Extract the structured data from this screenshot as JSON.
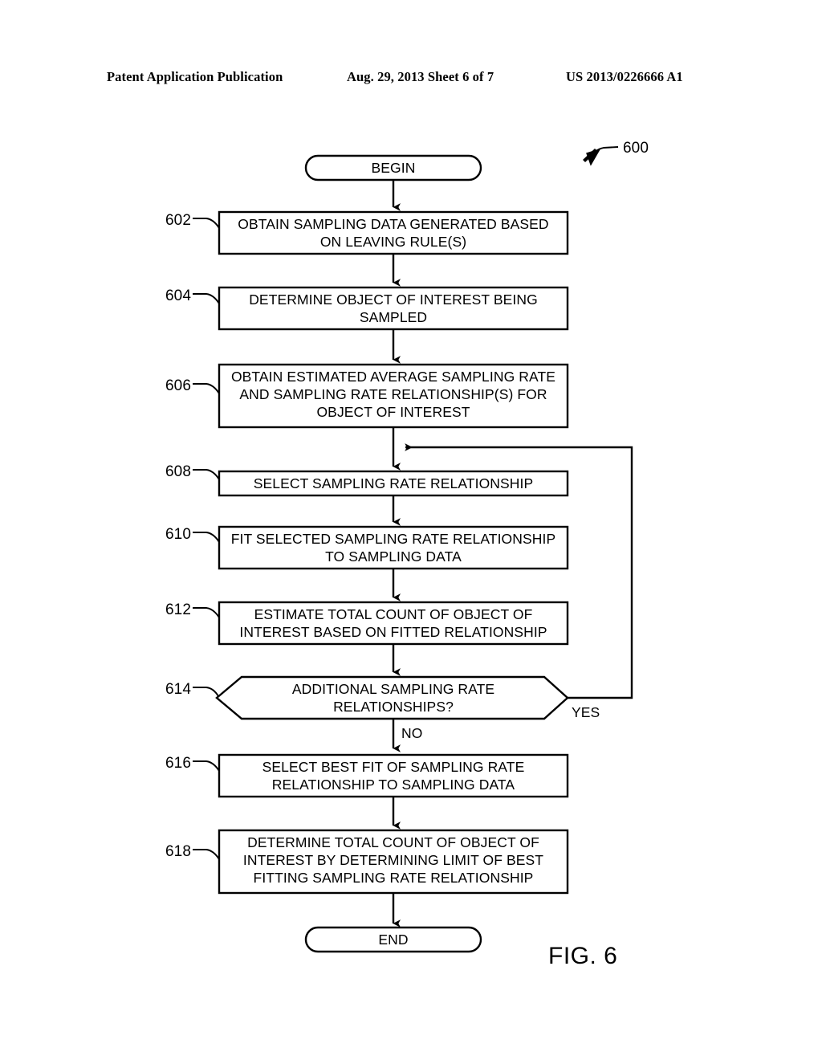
{
  "header": {
    "publication": "Patent Application Publication",
    "date_sheet": "Aug. 29, 2013  Sheet 6 of 7",
    "patent_number": "US 2013/0226666 A1"
  },
  "figure": {
    "caption": "FIG. 6",
    "diagram_ref": "600"
  },
  "flowchart": {
    "type": "process-flowchart",
    "start": {
      "ref": "",
      "label": "BEGIN"
    },
    "end": {
      "ref": "",
      "label": "END"
    },
    "steps": [
      {
        "ref": "602",
        "shape": "process",
        "lines": [
          "OBTAIN SAMPLING DATA GENERATED BASED",
          "ON LEAVING RULE(S)"
        ]
      },
      {
        "ref": "604",
        "shape": "process",
        "lines": [
          "DETERMINE OBJECT OF INTEREST BEING",
          "SAMPLED"
        ]
      },
      {
        "ref": "606",
        "shape": "process",
        "lines": [
          "OBTAIN ESTIMATED AVERAGE SAMPLING RATE",
          "AND SAMPLING RATE RELATIONSHIP(S) FOR",
          "OBJECT OF INTEREST"
        ]
      },
      {
        "ref": "608",
        "shape": "process",
        "lines": [
          "SELECT SAMPLING RATE RELATIONSHIP"
        ]
      },
      {
        "ref": "610",
        "shape": "process",
        "lines": [
          "FIT SELECTED SAMPLING RATE RELATIONSHIP",
          "TO SAMPLING DATA"
        ]
      },
      {
        "ref": "612",
        "shape": "process",
        "lines": [
          "ESTIMATE TOTAL COUNT OF OBJECT OF",
          "INTEREST BASED ON FITTED RELATIONSHIP"
        ]
      },
      {
        "ref": "614",
        "shape": "decision",
        "lines": [
          "ADDITIONAL SAMPLING RATE",
          "RELATIONSHIPS?"
        ],
        "branch_yes": "YES",
        "branch_no": "NO"
      },
      {
        "ref": "616",
        "shape": "process",
        "lines": [
          "SELECT BEST FIT OF SAMPLING RATE",
          "RELATIONSHIP TO SAMPLING DATA"
        ]
      },
      {
        "ref": "618",
        "shape": "process",
        "lines": [
          "DETERMINE TOTAL COUNT OF OBJECT OF",
          "INTEREST BY DETERMINING LIMIT OF BEST",
          "FITTING SAMPLING RATE RELATIONSHIP"
        ]
      }
    ],
    "feedback": {
      "from": "614",
      "to": "608",
      "label": "YES"
    }
  }
}
